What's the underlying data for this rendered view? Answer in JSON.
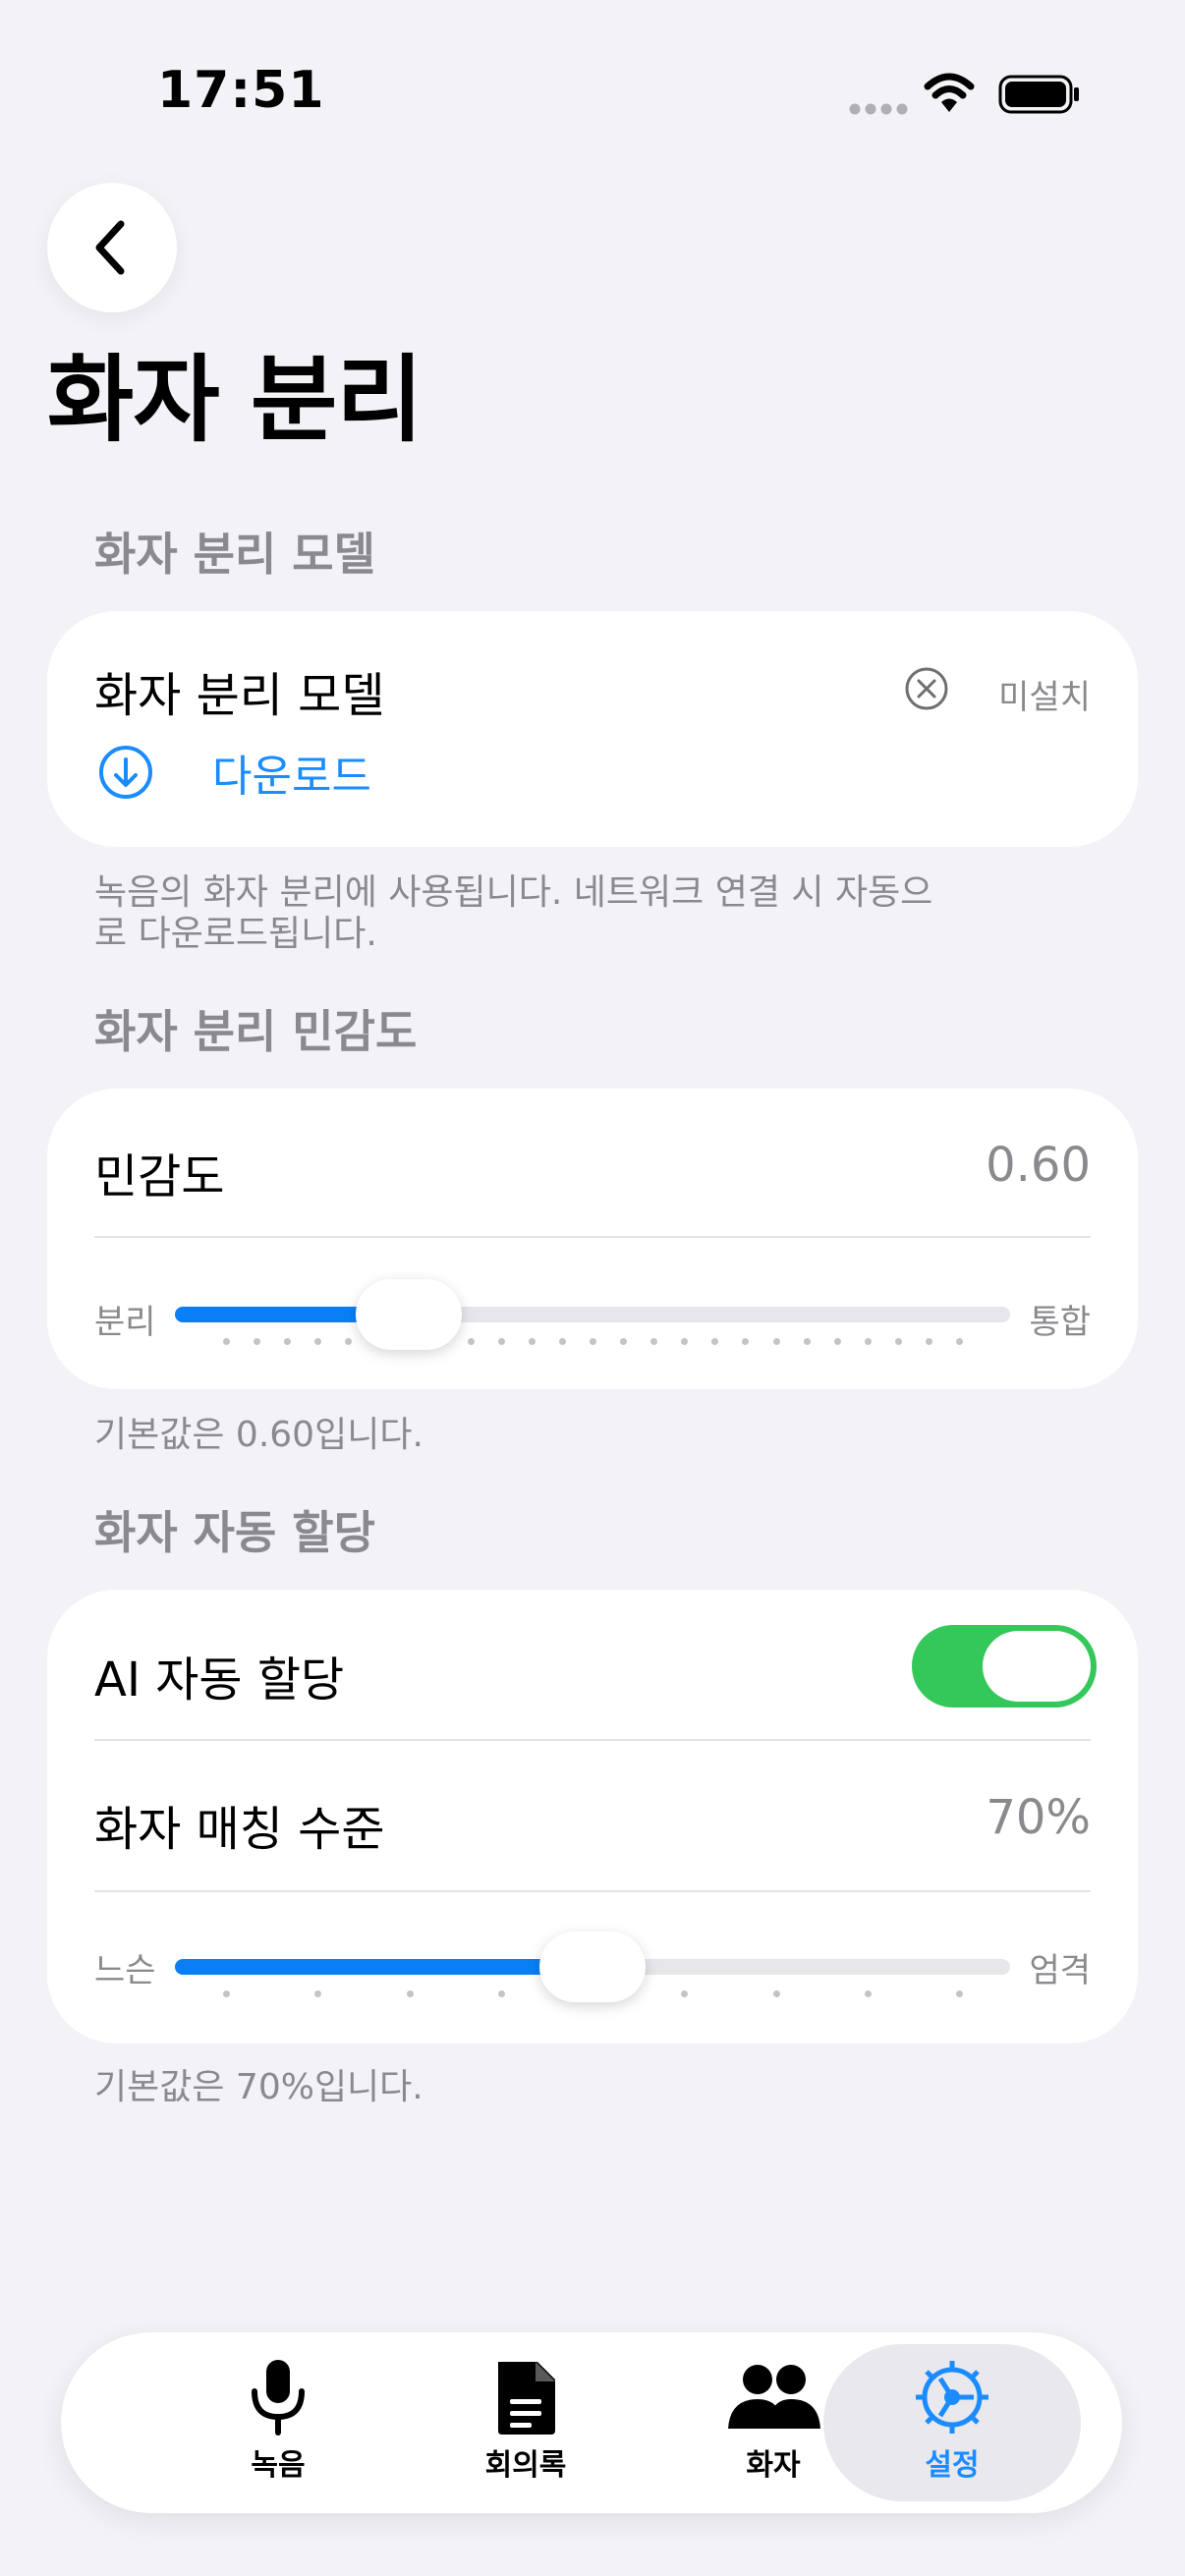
{
  "status_bar": {
    "time": "17:51"
  },
  "page": {
    "title": "화자 분리"
  },
  "sections": {
    "model": {
      "header": "화자 분리 모델",
      "row_title": "화자 분리 모델",
      "status": "미설치",
      "download_label": "다운로드",
      "footnote": "녹음의 화자 분리에 사용됩니다. 네트워크 연결 시 자동으로 다운로드됩니다."
    },
    "sensitivity": {
      "header": "화자 분리 민감도",
      "row_title": "민감도",
      "value": "0.60",
      "min_label": "분리",
      "max_label": "통합",
      "slider_fraction": 0.28,
      "footnote": "기본값은 0.60입니다."
    },
    "auto_assign": {
      "header": "화자 자동 할당",
      "ai_label": "AI 자동 할당",
      "ai_enabled": true,
      "match_title": "화자 매칭 수준",
      "match_value": "70%",
      "min_label": "느슨",
      "max_label": "엄격",
      "slider_fraction": 0.5,
      "footnote": "기본값은 70%입니다."
    }
  },
  "tabbar": {
    "tabs": [
      {
        "label": "녹음",
        "icon": "microphone-icon",
        "active": false
      },
      {
        "label": "회의록",
        "icon": "document-icon",
        "active": false
      },
      {
        "label": "화자",
        "icon": "people-icon",
        "active": false
      },
      {
        "label": "설정",
        "icon": "gear-icon",
        "active": true
      }
    ]
  },
  "colors": {
    "accent": "#1a8cff",
    "toggle_on": "#34c759",
    "background": "#f2f2f7",
    "secondary_text": "#8a8a8e"
  }
}
